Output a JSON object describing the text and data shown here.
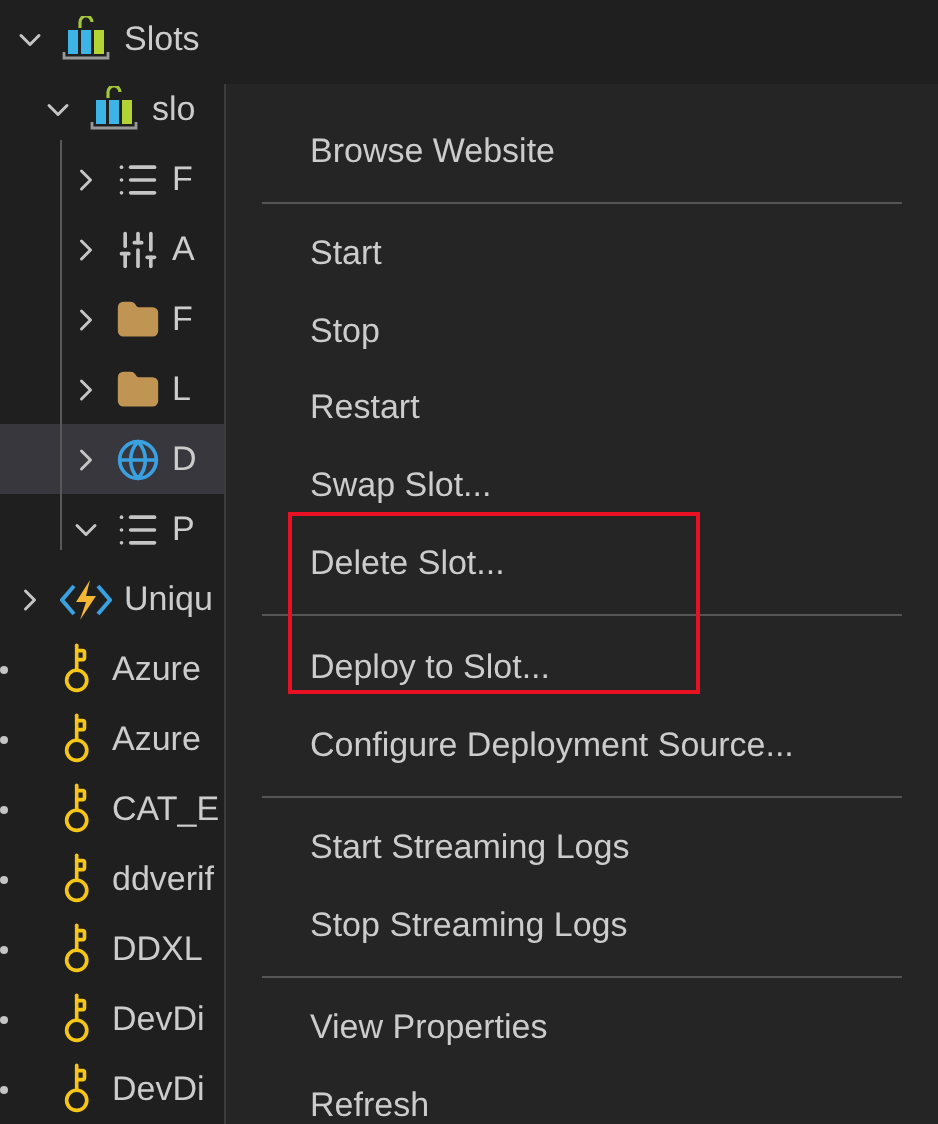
{
  "tree": [
    {
      "label": "Slots",
      "kind": "slots",
      "expanded": true,
      "selected": false,
      "children": [
        {
          "label": "slo",
          "kind": "app",
          "expanded": true,
          "selected": false,
          "children": [
            {
              "label": "F",
              "kind": "list",
              "expanded": false,
              "selected": false
            },
            {
              "label": "A",
              "kind": "settings",
              "expanded": false,
              "selected": false
            },
            {
              "label": "F",
              "kind": "folder",
              "expanded": false,
              "selected": false
            },
            {
              "label": "L",
              "kind": "folder",
              "expanded": false,
              "selected": false
            },
            {
              "label": "D",
              "kind": "globe",
              "expanded": false,
              "selected": true
            },
            {
              "label": "P",
              "kind": "list",
              "expanded": true,
              "selected": false
            }
          ]
        }
      ]
    },
    {
      "label": "Uniqu",
      "kind": "function_app",
      "expanded": false,
      "selected": false
    },
    {
      "label": "Azure",
      "kind": "key",
      "selected": false
    },
    {
      "label": "Azure",
      "kind": "key",
      "selected": false
    },
    {
      "label": "CAT_E",
      "kind": "key",
      "selected": false
    },
    {
      "label": "ddverif",
      "kind": "key",
      "selected": false
    },
    {
      "label": "DDXL",
      "kind": "key",
      "selected": false
    },
    {
      "label": "DevDi",
      "kind": "key",
      "selected": false
    },
    {
      "label": "DevDi",
      "kind": "key",
      "selected": false
    }
  ],
  "context_menu": [
    {
      "kind": "item",
      "label": "Browse Website"
    },
    {
      "kind": "separator"
    },
    {
      "kind": "item",
      "label": "Start"
    },
    {
      "kind": "item",
      "label": "Stop"
    },
    {
      "kind": "item",
      "label": "Restart"
    },
    {
      "kind": "item",
      "label": "Swap Slot..."
    },
    {
      "kind": "highlight",
      "items": [
        {
          "kind": "item",
          "label": "Delete Slot..."
        },
        {
          "kind": "separator"
        },
        {
          "kind": "item",
          "label": "Deploy to Slot..."
        }
      ]
    },
    {
      "kind": "item",
      "label": "Configure Deployment Source..."
    },
    {
      "kind": "separator"
    },
    {
      "kind": "item",
      "label": "Start Streaming Logs"
    },
    {
      "kind": "item",
      "label": "Stop Streaming Logs"
    },
    {
      "kind": "separator"
    },
    {
      "kind": "item",
      "label": "View Properties"
    },
    {
      "kind": "item",
      "label": "Refresh"
    }
  ]
}
